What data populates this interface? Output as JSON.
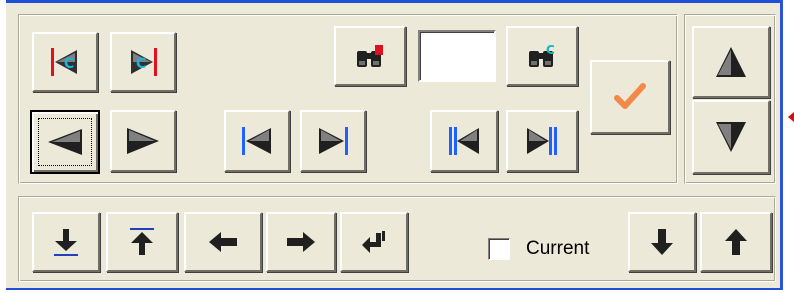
{
  "search": {
    "value": ""
  },
  "current_checkbox": {
    "label": "Current",
    "checked": false
  },
  "colors": {
    "panel": "#ece9d8",
    "window_border": "#1f4fd6",
    "marker_red": "#e01020",
    "marker_blue": "#2060ff",
    "arrow_dark": "#000000",
    "check_orange": "#f08a4b",
    "binocular_red": "#e01020",
    "binocular_teal": "#10b8b8"
  },
  "icons": {
    "first_record": "red-bar-left-arrow-icon",
    "last_record": "red-bar-right-arrow-icon",
    "find": "binoculars-red-icon",
    "find_next": "binoculars-teal-icon",
    "confirm": "orange-checkmark-icon",
    "move_up": "triangle-up-icon",
    "move_down": "triangle-down-icon"
  }
}
